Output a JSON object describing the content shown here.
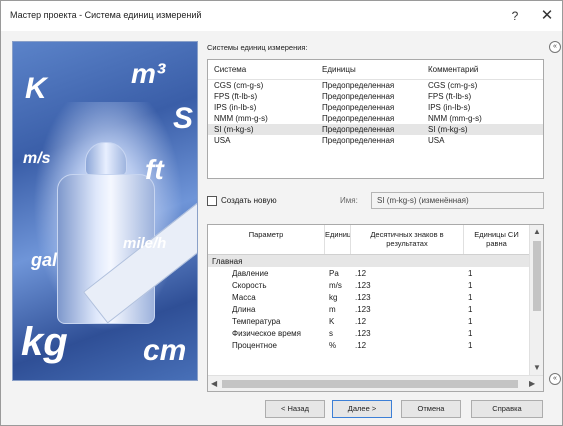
{
  "window": {
    "title": "Мастер проекта - Система единиц измерений",
    "help_symbol": "?",
    "close_symbol": "✕"
  },
  "art_units": [
    "K",
    "m³",
    "S",
    "m/s",
    "ft",
    "gal",
    "mile/h",
    "kg",
    "cm"
  ],
  "systems": {
    "label": "Системы единиц измерения:",
    "columns": [
      "Система",
      "Единицы",
      "Комментарий"
    ],
    "rows": [
      [
        "CGS (cm-g-s)",
        "Предопределенная",
        "CGS (cm-g-s)"
      ],
      [
        "FPS (ft-lb-s)",
        "Предопределенная",
        "FPS (ft-lb-s)"
      ],
      [
        "IPS (in-lb-s)",
        "Предопределенная",
        "IPS (in-lb-s)"
      ],
      [
        "NMM (mm-g-s)",
        "Предопределенная",
        "NMM (mm-g-s)"
      ],
      [
        "SI (m-kg-s)",
        "Предопределенная",
        "SI (m-kg-s)"
      ],
      [
        "USA",
        "Предопределенная",
        "USA"
      ]
    ],
    "selected_index": 4
  },
  "create": {
    "checkbox_label": "Создать новую",
    "checked": false,
    "name_label": "Имя:",
    "name_value": "SI (m-kg-s) (изменённая)"
  },
  "grid": {
    "columns": [
      "Параметр",
      "Единица",
      "Десятичных знаков в результатах",
      "Единицы СИ равна"
    ],
    "group": "Главная",
    "rows": [
      [
        "Давление",
        "Pa",
        ".12",
        "1"
      ],
      [
        "Скорость",
        "m/s",
        ".123",
        "1"
      ],
      [
        "Масса",
        "kg",
        ".123",
        "1"
      ],
      [
        "Длина",
        "m",
        ".123",
        "1"
      ],
      [
        "Температура",
        "K",
        ".12",
        "1"
      ],
      [
        "Физическое время",
        "s",
        ".123",
        "1"
      ],
      [
        "Процентное",
        "%",
        ".12",
        "1"
      ]
    ]
  },
  "buttons": {
    "back": "< Назад",
    "next": "Далее >",
    "cancel": "Отмена",
    "help": "Справка"
  },
  "side_circle_symbol": "«"
}
